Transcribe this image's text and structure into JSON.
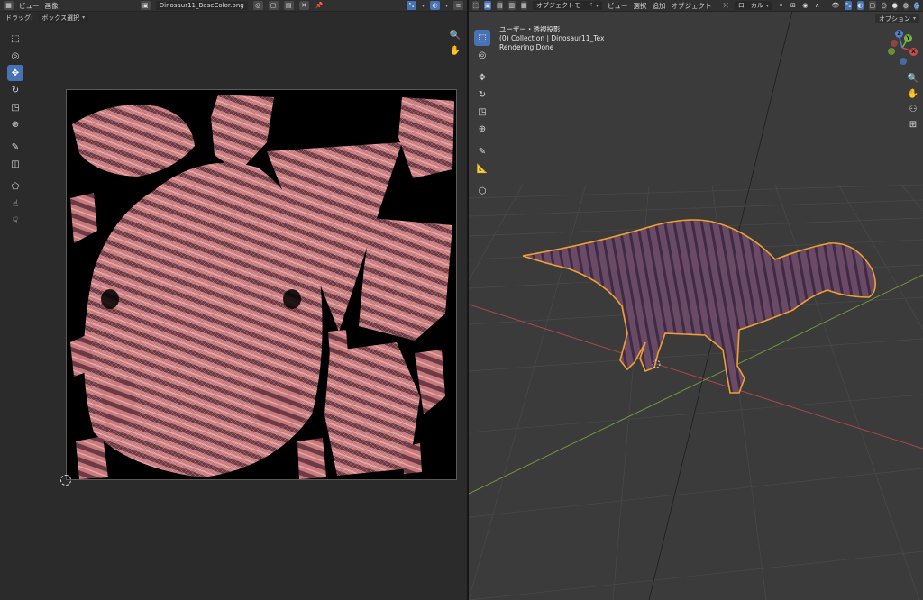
{
  "uv_editor": {
    "header": {
      "menus": [
        "ビュー",
        "画像"
      ],
      "image_name": "Dinosaur11_BaseColor.png"
    },
    "subheader": {
      "drag_label": "ドラッグ:",
      "drag_mode": "ボックス選択"
    },
    "tools": [
      "cursor-tool-icon",
      "cursor-3d-tool-icon",
      "move-tool-icon",
      "rotate-tool-icon",
      "scale-tool-icon",
      "transform-tool-icon",
      "annotate-tool-icon",
      "box-tool-icon",
      "grab-tool-icon",
      "relax-tool-icon",
      "pinch-tool-icon"
    ]
  },
  "viewport": {
    "header": {
      "mode": "オブジェクトモード",
      "menus": [
        "ビュー",
        "選択",
        "追加",
        "オブジェクト"
      ],
      "orientation": "ローカル",
      "options": "オプション"
    },
    "overlay": {
      "view_name": "ユーザー・透視投影",
      "collection": "(0) Collection | Dinosaur11_Tex",
      "status": "Rendering Done"
    },
    "gizmo": {
      "z": "Z",
      "y": "Y",
      "x": "X"
    },
    "colors": {
      "accent": "#4772b3",
      "selection_outline": "#f0a030",
      "x_axis": "#c84a4a",
      "y_axis": "#7ab33a"
    }
  }
}
